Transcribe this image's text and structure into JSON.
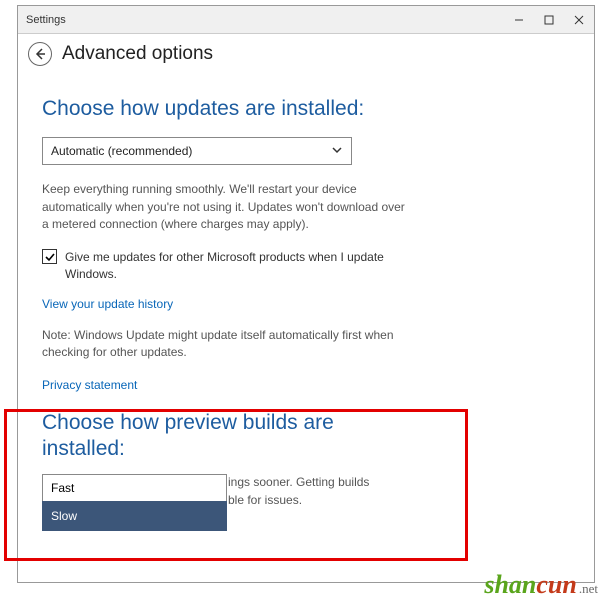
{
  "titlebar": {
    "title": "Settings"
  },
  "header": {
    "page_title": "Advanced options"
  },
  "updates": {
    "heading": "Choose how updates are installed:",
    "dropdown_value": "Automatic (recommended)",
    "description": "Keep everything running smoothly. We'll restart your device automatically when you're not using it. Updates won't download over a metered connection (where charges may apply).",
    "checkbox_checked": true,
    "checkbox_label": "Give me updates for other Microsoft products when I update Windows.",
    "history_link": "View your update history",
    "note": "Note: Windows Update might update itself automatically first when checking for other updates.",
    "privacy_link": "Privacy statement"
  },
  "preview": {
    "heading": "Choose how preview builds are installed:",
    "truncated_line1": "ings sooner. Getting builds",
    "truncated_line2": "ble for issues.",
    "options": {
      "fast": "Fast",
      "slow": "Slow"
    }
  },
  "watermark": {
    "part1": "shan",
    "part2": "cun",
    "suffix": ".net"
  }
}
